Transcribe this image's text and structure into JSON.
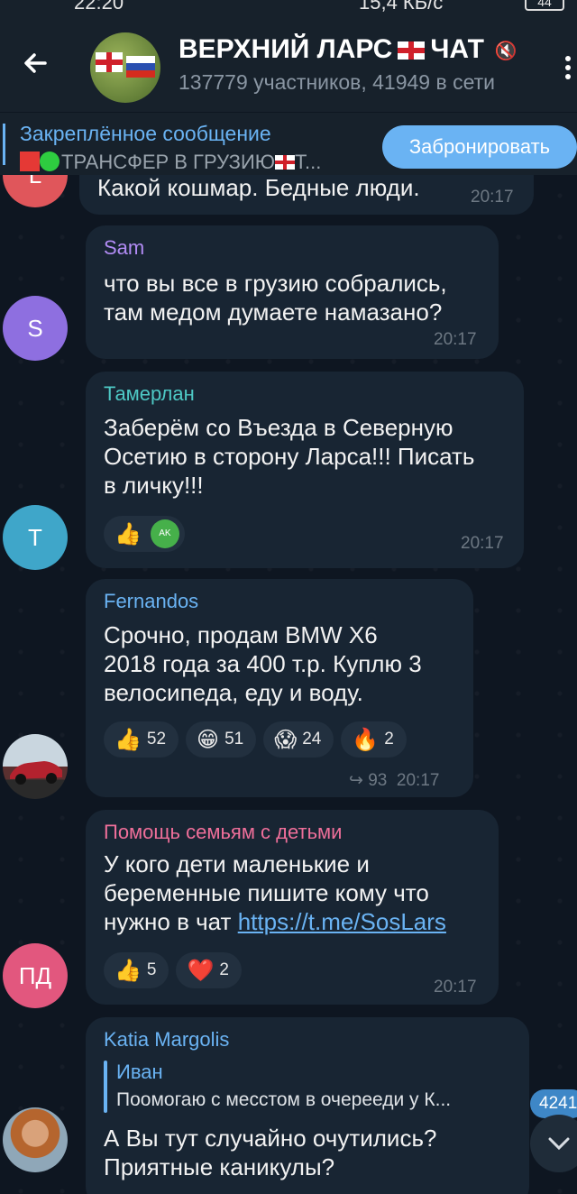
{
  "status": {
    "time": "22:20",
    "network": "15,4 КБ/с",
    "battery": "44"
  },
  "header": {
    "title": "ВЕРХНИЙ ЛАРС",
    "title_suffix": "ЧАТ",
    "subtitle": "137779 участников, 41949 в сети",
    "back_icon": "arrow-left-icon",
    "menu_icon": "more-vertical-icon"
  },
  "pinned": {
    "label": "Закреплённое сообщение",
    "text_a": "ТРАНСФЕР В ГРУЗИЮ",
    "text_b": "Т...",
    "button_label": "Забронировать"
  },
  "messages": [
    {
      "avatar_letter": "L",
      "avatar_color": "#e0565b",
      "text": "Какой кошмар. Бедные люди.",
      "time": "20:17"
    },
    {
      "name": "Sam",
      "name_color": "#b28cf5",
      "avatar_letter": "S",
      "avatar_color": "#8e6fe0",
      "text_lines": [
        "что вы все в грузию собрались,",
        "там медом думаете намазано?"
      ],
      "time": "20:17"
    },
    {
      "name": "Тамерлан",
      "name_color": "#4ec9c5",
      "avatar_letter": "T",
      "avatar_color": "#3fa6c9",
      "text_lines": [
        "Заберём со Въезда в Северную",
        "Осетию в сторону Ларса!!! Писать",
        "в личку!!!"
      ],
      "reactions": [
        {
          "emoji": "👍",
          "count": "",
          "avatar_text": "AK"
        }
      ],
      "time": "20:17"
    },
    {
      "name": "Fernandos",
      "name_color": "#6ab3f3",
      "text_lines": [
        "Срочно, продам BMW X6",
        "2018 года за 400 т.р. Куплю 3",
        "велосипеда, еду и воду."
      ],
      "reactions": [
        {
          "emoji": "👍",
          "count": "52"
        },
        {
          "emoji": "😁",
          "count": "51"
        },
        {
          "emoji": "😱",
          "count": "24"
        },
        {
          "emoji": "🔥",
          "count": "2"
        }
      ],
      "forwards": "93",
      "time": "20:17"
    },
    {
      "name": "Помощь семьям с детьми",
      "name_color": "#ef6f9a",
      "avatar_letter": "ПД",
      "avatar_color": "#e2577e",
      "text_lines": [
        "У кого дети маленькие и",
        "беременные пишите кому что"
      ],
      "text_last": "нужно в чат",
      "link": "https://t.me/SosLars",
      "reactions": [
        {
          "emoji": "👍",
          "count": "5"
        },
        {
          "emoji": "❤️",
          "count": "2"
        }
      ],
      "time": "20:17"
    },
    {
      "name": "Katia Margolis",
      "name_color": "#6ab3f3",
      "quote_name": "Иван",
      "quote_text": "Поомогаю с месстом в очерееди у К...",
      "text_lines": [
        "А Вы тут случайно очутились?",
        "Приятные каникулы?"
      ]
    }
  ],
  "unread_count": "4241"
}
